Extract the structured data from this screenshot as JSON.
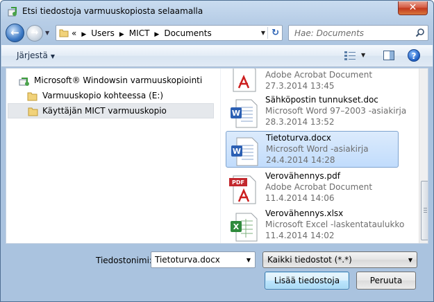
{
  "window": {
    "title": "Etsi tiedostoja varmuuskopiosta selaamalla",
    "close_label": "✕"
  },
  "nav": {
    "breadcrumb_overflow": "«",
    "breadcrumbs": [
      "Users",
      "MICT",
      "Documents"
    ],
    "search_placeholder": "Hae: Documents"
  },
  "toolbar": {
    "organize_label": "Järjestä"
  },
  "tree": [
    {
      "label": "Microsoft® Windowsin varmuuskopiointi"
    },
    {
      "label": "Varmuuskopio kohteessa (E:)"
    },
    {
      "label": "Käyttäjän MICT varmuuskopio",
      "selected": true
    }
  ],
  "files": [
    {
      "name": "",
      "type": "Adobe Acrobat Document",
      "date": "27.3.2014 13:45",
      "icon": "pdf-icon"
    },
    {
      "name": "Sähköpostin tunnukset.doc",
      "type": "Microsoft Word 97–2003 -asiakirja",
      "date": "28.3.2014 13:52",
      "icon": "word-icon"
    },
    {
      "name": "Tietoturva.docx",
      "type": "Microsoft Word -asiakirja",
      "date": "24.4.2014 14:28",
      "icon": "word-icon",
      "selected": true
    },
    {
      "name": "Verovähennys.pdf",
      "type": "Adobe Acrobat Document",
      "date": "11.4.2014 14:06",
      "icon": "pdf-icon"
    },
    {
      "name": "Verovähennys.xlsx",
      "type": "Microsoft Excel -laskentataulukko",
      "date": "11.4.2014 14:02",
      "icon": "excel-icon"
    }
  ],
  "bottom": {
    "filename_label": "Tiedostonimi:",
    "filename_value": "Tietoturva.docx",
    "filter_value": "Kaikki tiedostot (*.*)",
    "add_button": "Lisää tiedostoja",
    "cancel_button": "Peruuta"
  }
}
